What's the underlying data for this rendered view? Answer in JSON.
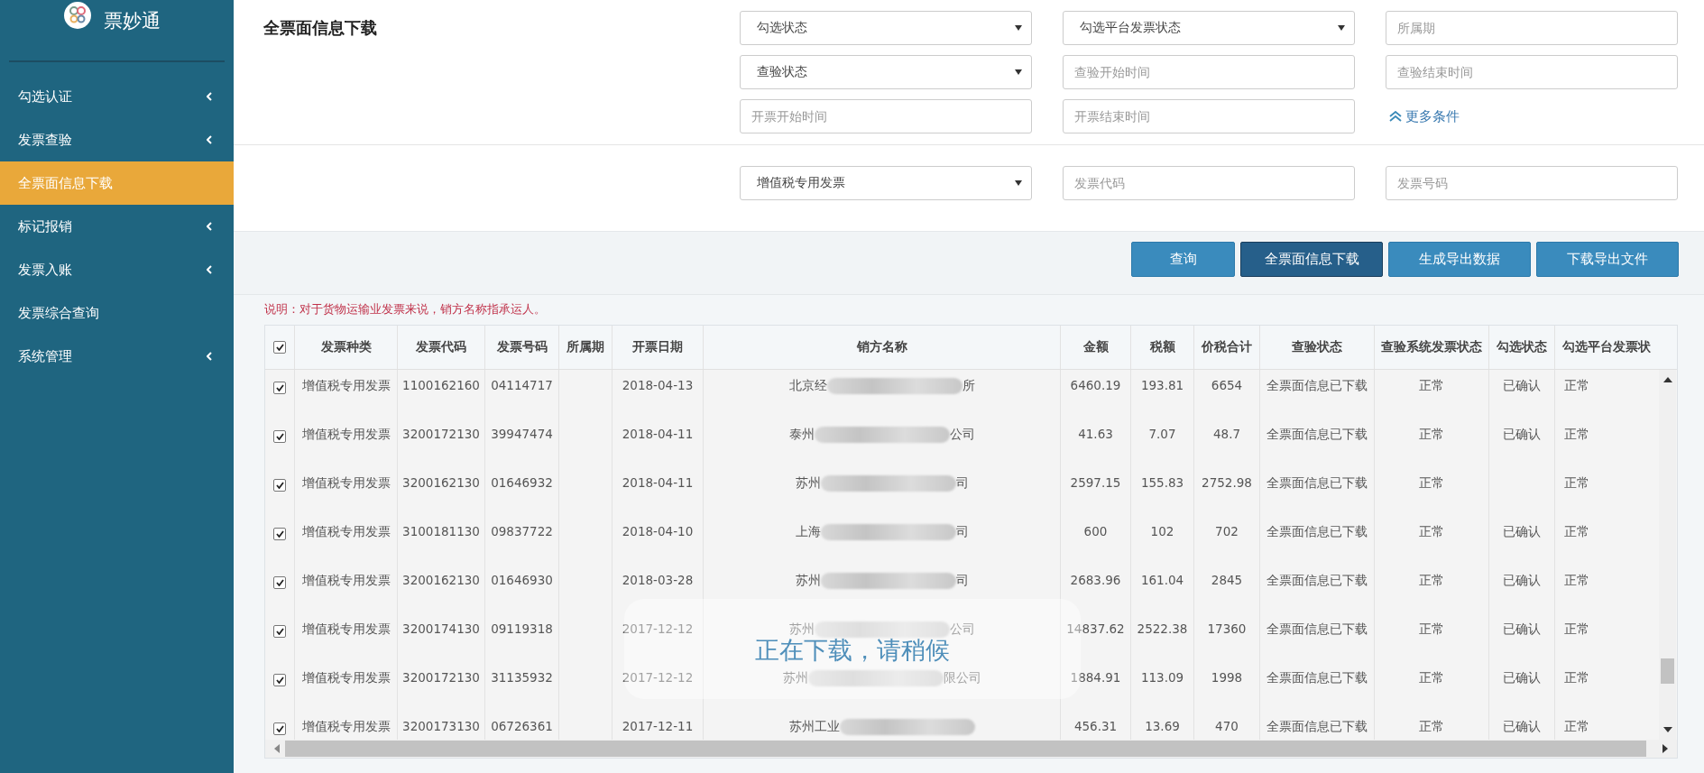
{
  "sidebar": {
    "brand": "票妙通",
    "items": [
      {
        "label": "勾选认证",
        "expandable": true,
        "selected": false
      },
      {
        "label": "发票查验",
        "expandable": true,
        "selected": false
      },
      {
        "label": "全票面信息下载",
        "expandable": false,
        "selected": true
      },
      {
        "label": "标记报销",
        "expandable": true,
        "selected": false
      },
      {
        "label": "发票入账",
        "expandable": true,
        "selected": false
      },
      {
        "label": "发票综合查询",
        "expandable": false,
        "selected": false
      },
      {
        "label": "系统管理",
        "expandable": true,
        "selected": false
      }
    ]
  },
  "page_title": "全票面信息下载",
  "filters": [
    {
      "kind": "select",
      "value": "勾选状态"
    },
    {
      "kind": "select",
      "value": "勾选平台发票状态"
    },
    {
      "kind": "input",
      "placeholder": "所属期"
    },
    {
      "kind": "select",
      "value": "查验状态"
    },
    {
      "kind": "input",
      "placeholder": "查验开始时间"
    },
    {
      "kind": "input",
      "placeholder": "查验结束时间"
    },
    {
      "kind": "input",
      "placeholder": "开票开始时间"
    },
    {
      "kind": "input",
      "placeholder": "开票结束时间"
    },
    {
      "kind": "link",
      "label": "更多条件"
    }
  ],
  "filters_2": [
    {
      "kind": "select",
      "value": "增值税专用发票"
    },
    {
      "kind": "input",
      "placeholder": "发票代码"
    },
    {
      "kind": "input",
      "placeholder": "发票号码"
    }
  ],
  "buttons": [
    {
      "label": "查询",
      "selected": false
    },
    {
      "label": "全票面信息下载",
      "selected": true
    },
    {
      "label": "生成导出数据",
      "selected": false
    },
    {
      "label": "下载导出文件",
      "selected": false
    }
  ],
  "note": "说明：对于货物运输业发票来说，销方名称指承运人。",
  "table": {
    "all_checked": true,
    "columns": [
      "发票种类",
      "发票代码",
      "发票号码",
      "所属期",
      "开票日期",
      "销方名称",
      "金额",
      "税额",
      "价税合计",
      "查验状态",
      "查验系统发票状态",
      "勾选状态",
      "勾选平台发票状"
    ],
    "rows": [
      {
        "checked": true,
        "cells": [
          "增值税专用发票",
          "1100162160",
          "04114717",
          "",
          "2018-04-13",
          {
            "head": "北京经",
            "tail": "所"
          },
          "6460.19",
          "193.81",
          "6654",
          "全票面信息已下载",
          "正常",
          "已确认",
          "正常"
        ]
      },
      {
        "checked": true,
        "cells": [
          "增值税专用发票",
          "3200172130",
          "39947474",
          "",
          "2018-04-11",
          {
            "head": "泰州",
            "tail": "公司"
          },
          "41.63",
          "7.07",
          "48.7",
          "全票面信息已下载",
          "正常",
          "已确认",
          "正常"
        ]
      },
      {
        "checked": true,
        "cells": [
          "增值税专用发票",
          "3200162130",
          "01646932",
          "",
          "2018-04-11",
          {
            "head": "苏州",
            "tail": "司"
          },
          "2597.15",
          "155.83",
          "2752.98",
          "全票面信息已下载",
          "正常",
          "",
          "正常"
        ]
      },
      {
        "checked": true,
        "cells": [
          "增值税专用发票",
          "3100181130",
          "09837722",
          "",
          "2018-04-10",
          {
            "head": "上海",
            "tail": "司"
          },
          "600",
          "102",
          "702",
          "全票面信息已下载",
          "正常",
          "已确认",
          "正常"
        ]
      },
      {
        "checked": true,
        "cells": [
          "增值税专用发票",
          "3200162130",
          "01646930",
          "",
          "2018-03-28",
          {
            "head": "苏州",
            "tail": "司"
          },
          "2683.96",
          "161.04",
          "2845",
          "全票面信息已下载",
          "正常",
          "已确认",
          "正常"
        ]
      },
      {
        "checked": true,
        "cells": [
          "增值税专用发票",
          "3200174130",
          "09119318",
          "",
          "2017-12-12",
          {
            "head": "苏州",
            "tail": "公司"
          },
          "14837.62",
          "2522.38",
          "17360",
          "全票面信息已下载",
          "正常",
          "已确认",
          "正常"
        ]
      },
      {
        "checked": true,
        "cells": [
          "增值税专用发票",
          "3200172130",
          "31135932",
          "",
          "2017-12-12",
          {
            "head": "苏州",
            "tail": "限公司"
          },
          "1884.91",
          "113.09",
          "1998",
          "全票面信息已下载",
          "正常",
          "已确认",
          "正常"
        ]
      },
      {
        "checked": true,
        "cells": [
          "增值税专用发票",
          "3200173130",
          "06726361",
          "",
          "2017-12-11",
          {
            "head": "苏州工业"
          },
          "456.31",
          "13.69",
          "470",
          "全票面信息已下载",
          "正常",
          "已确认",
          "正常"
        ]
      }
    ]
  },
  "loading_message": "正在下载，请稍候"
}
